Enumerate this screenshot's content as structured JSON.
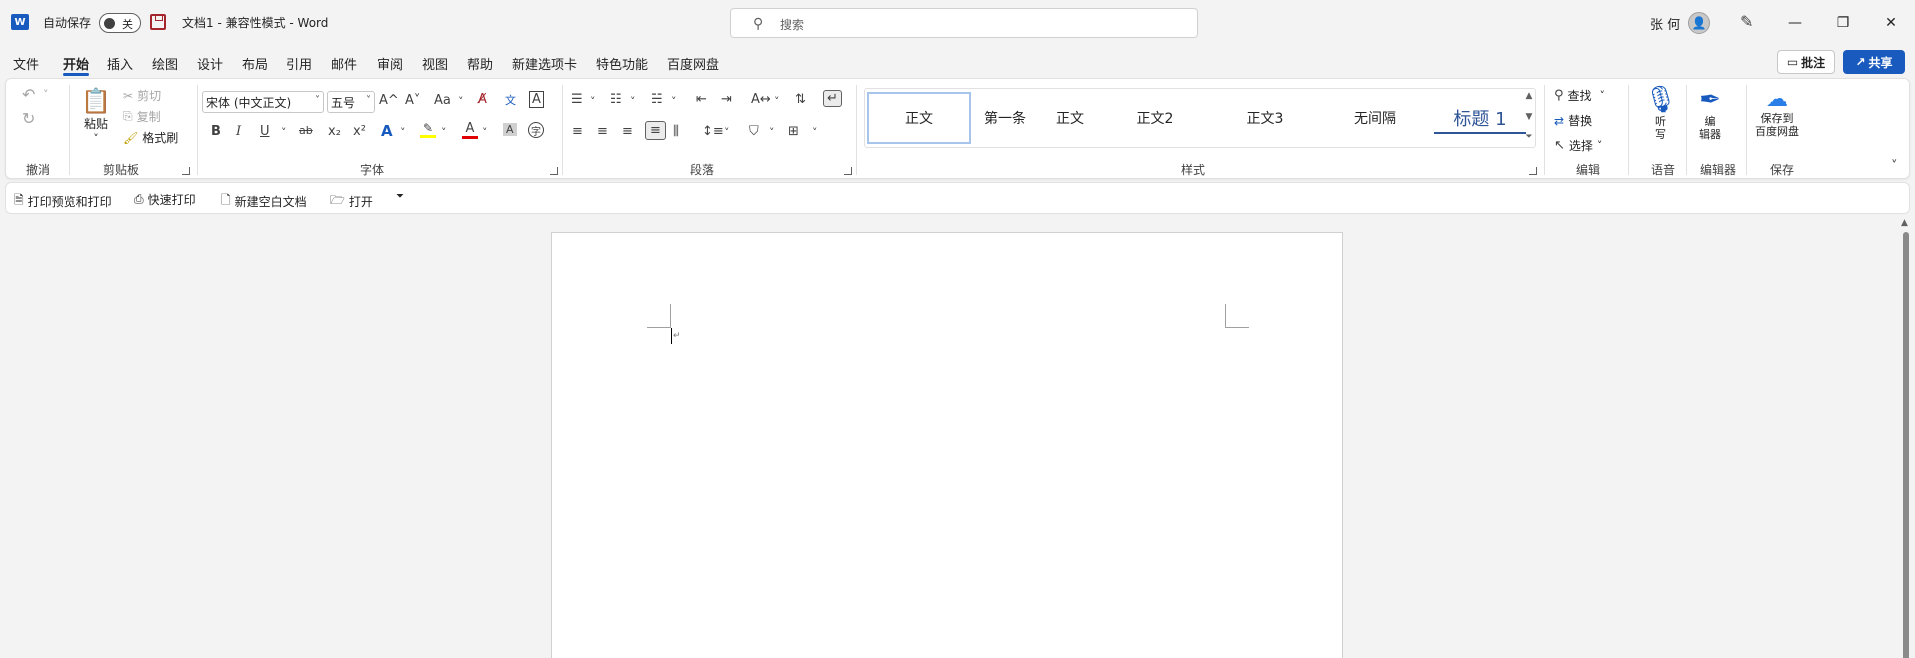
{
  "titlebar": {
    "logo": "W",
    "autosave_label": "自动保存",
    "autosave_state": "关",
    "doc_title": "文档1  -  兼容性模式  -  Word",
    "search_placeholder": "搜索",
    "user": "张 何",
    "avatar_icon": "person-icon",
    "controls": {
      "minimize": "—",
      "restore": "❐",
      "close": "✕"
    }
  },
  "tabs": [
    "文件",
    "开始",
    "插入",
    "绘图",
    "设计",
    "布局",
    "引用",
    "邮件",
    "审阅",
    "视图",
    "帮助",
    "新建选项卡",
    "特色功能",
    "百度网盘"
  ],
  "active_tab": "开始",
  "actions": {
    "comment": "批注",
    "share": "共享"
  },
  "ribbon": {
    "undo": {
      "label": "撤消"
    },
    "clipboard": {
      "label": "剪贴板",
      "paste": "粘贴",
      "cut": "剪切",
      "copy": "复制",
      "format_painter": "格式刷"
    },
    "font": {
      "label": "字体",
      "font_name": "宋体 (中文正文)",
      "font_size": "五号",
      "bold": "B",
      "italic": "I",
      "underline": "U",
      "strike": "ab",
      "subscript": "x₂",
      "superscript": "x²",
      "grow": "A^",
      "shrink": "A˅",
      "case": "Aa",
      "highlight_color": "#ffff00",
      "font_color": "#e00000"
    },
    "paragraph": {
      "label": "段落"
    },
    "styles": {
      "label": "样式",
      "items": [
        "正文",
        "第一条",
        "正文",
        "正文2",
        "正文3",
        "无间隔",
        "标题 1"
      ],
      "selected": "正文"
    },
    "editing": {
      "label": "编辑",
      "find": "查找",
      "replace": "替换",
      "select": "选择"
    },
    "voice": {
      "label": "语音",
      "dictate": "听\n写"
    },
    "editor": {
      "label": "编辑器",
      "editor": "编\n辑器"
    },
    "save": {
      "label": "保存",
      "save_to_baidu": "保存到\n百度网盘"
    }
  },
  "qat": [
    "打印预览和打印",
    "快速打印",
    "新建空白文档",
    "打开"
  ],
  "colors": {
    "brand": "#185abd",
    "ribbon_bg": "#ffffff",
    "app_bg": "#f3f3f3"
  }
}
